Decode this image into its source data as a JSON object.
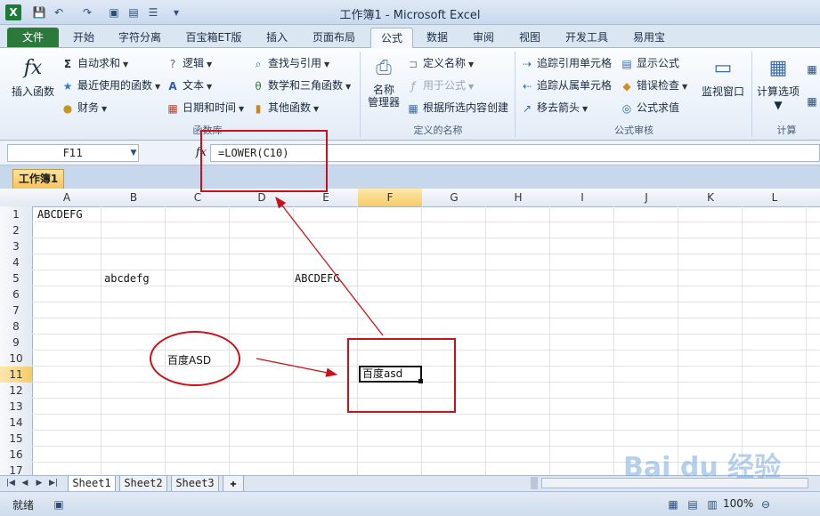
{
  "window": {
    "title": "工作簿1 - Microsoft Excel"
  },
  "quick_access": {
    "app_icon": "X"
  },
  "tabs": [
    "文件",
    "开始",
    "字符分离",
    "百宝箱ET版",
    "插入",
    "页面布局",
    "公式",
    "数据",
    "审阅",
    "视图",
    "开发工具",
    "易用宝"
  ],
  "active_tab": "公式",
  "ribbon": {
    "insert_function": "插入函数",
    "library": {
      "autosum": "自动求和",
      "recent": "最近使用的函数",
      "finance": "财务",
      "logic": "逻辑",
      "text": "文本",
      "datetime": "日期和时间",
      "lookup": "查找与引用",
      "math": "数学和三角函数",
      "other": "其他函数",
      "label": "函数库"
    },
    "names": {
      "manager_line1": "名称",
      "manager_line2": "管理器",
      "define": "定义名称",
      "use_in_formula": "用于公式",
      "create_from_selection": "根据所选内容创建",
      "label": "定义的名称"
    },
    "audit": {
      "trace_precedents": "追踪引用单元格",
      "trace_dependents": "追踪从属单元格",
      "remove_arrows": "移去箭头",
      "show_formulas": "显示公式",
      "error_checking": "错误检查",
      "evaluate": "公式求值",
      "watch_window": "监视窗口",
      "label": "公式审核"
    },
    "calc": {
      "options": "计算选项",
      "label": "计算"
    }
  },
  "formula_bar": {
    "name_box": "F11",
    "fx": "fx",
    "formula": "=LOWER(C10)"
  },
  "workbook_tab": "工作簿1",
  "grid": {
    "columns": [
      "A",
      "B",
      "C",
      "D",
      "E",
      "F",
      "G",
      "H",
      "I",
      "J",
      "K",
      "L"
    ],
    "rows": [
      "1",
      "2",
      "3",
      "4",
      "5",
      "6",
      "7",
      "8",
      "9",
      "10",
      "11",
      "12",
      "13",
      "14",
      "15",
      "16",
      "17"
    ],
    "selected_column": "F",
    "selected_row": "11",
    "cells": {
      "A1": "ABCDEFG",
      "B5": "abcdefg",
      "E5": "ABCDEFG",
      "C10": "百度ASD",
      "F11": "百度asd"
    }
  },
  "sheets": [
    "Sheet1",
    "Sheet2",
    "Sheet3"
  ],
  "active_sheet": "Sheet1",
  "status": {
    "ready": "就绪",
    "zoom": "100%"
  },
  "watermark": {
    "text": "Bai du 经验"
  },
  "colors": {
    "annotation_red": "#c8111a",
    "file_tab_green": "#2a7a3c",
    "selection_gold": "#f7cc66"
  }
}
